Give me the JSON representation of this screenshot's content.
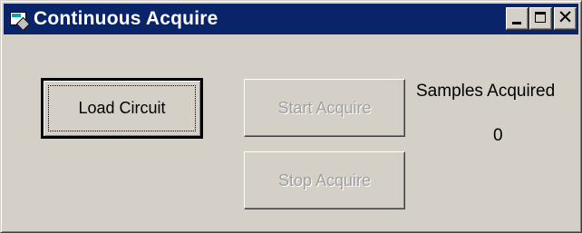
{
  "window": {
    "title": "Continuous Acquire",
    "buttons": {
      "minimize": "minimize",
      "maximize": "maximize",
      "close": "✕"
    }
  },
  "controls": {
    "load_label": "Load Circuit",
    "start_label": "Start Acquire",
    "stop_label": "Stop Acquire",
    "samples_label": "Samples Acquired",
    "samples_value": "0"
  },
  "colors": {
    "titlebar": "#0a246a",
    "face": "#d4d0c8",
    "disabled_text": "#a0a0a0"
  },
  "icons": {
    "app": "app-window-icon"
  }
}
